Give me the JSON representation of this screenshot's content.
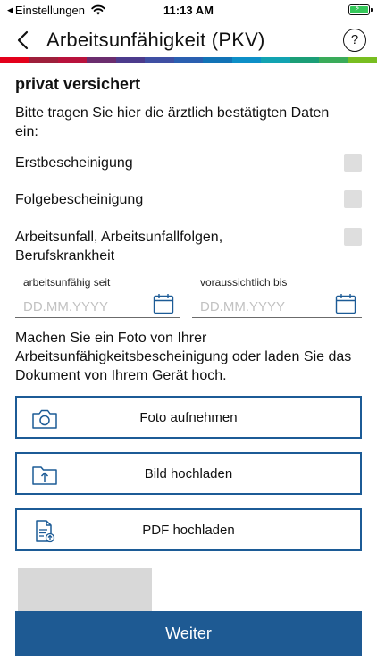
{
  "status_bar": {
    "back_label": "Einstellungen",
    "time": "11:13 AM",
    "battery_color": "#34c759"
  },
  "nav": {
    "title": "Arbeitsunfähigkeit (PKV)",
    "back_icon": "chevron-left-icon",
    "help_icon": "question-circle-icon",
    "help_glyph": "?"
  },
  "supergraphic_colors": [
    "#e3001b",
    "#9e1f3b",
    "#b8123c",
    "#6b2d6e",
    "#4c3b8c",
    "#3f4fa3",
    "#2a5fb0",
    "#1273b6",
    "#0d8fc7",
    "#12a3b1",
    "#1b9e77",
    "#3aab5a",
    "#78be20"
  ],
  "form": {
    "section_heading": "privat versichert",
    "intro": "Bitte tragen Sie hier die ärztlich bestätigten Daten ein:",
    "checkboxes": [
      {
        "label": "Erstbescheinigung",
        "checked": false
      },
      {
        "label": "Folgebescheinigung",
        "checked": false
      },
      {
        "label": "Arbeitsunfall, Arbeitsunfallfolgen, Berufskrankheit",
        "checked": false
      }
    ],
    "date_from": {
      "label": "arbeitsunfähig seit",
      "placeholder": "DD.MM.YYYY",
      "icon": "calendar-icon"
    },
    "date_to": {
      "label": "voraussichtlich bis",
      "placeholder": "DD.MM.YYYY",
      "icon": "calendar-icon"
    },
    "upload_instructions": "Machen Sie ein Foto von Ihrer Arbeitsunfähigkeitsbescheinigung oder laden Sie das Dokument von Ihrem Gerät hoch."
  },
  "actions": [
    {
      "label": "Foto aufnehmen",
      "icon": "camera-icon"
    },
    {
      "label": "Bild hochladen",
      "icon": "folder-upload-icon"
    },
    {
      "label": "PDF hochladen",
      "icon": "pdf-upload-icon"
    }
  ],
  "primary_button": {
    "label": "Weiter"
  },
  "accent_color": "#1c5b96"
}
